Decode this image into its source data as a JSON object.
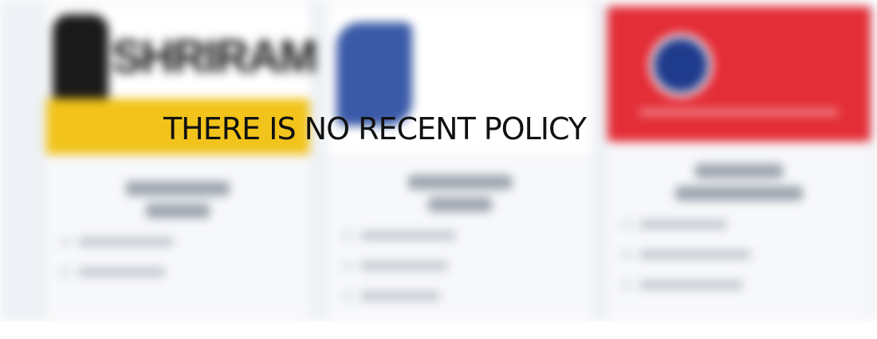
{
  "message": {
    "text": "THERE IS NO RECENT POLICY"
  },
  "background": {
    "note_colors": {
      "shriram_yellow": "#f2c31a",
      "manipal_blue": "#3a5aa8",
      "kotak_red": "#e32d37",
      "kotak_navy": "#1f3b8c"
    },
    "cards": [
      {
        "logo_icon": "shriram-logo",
        "logo_text": "SHRIRAM"
      },
      {
        "logo_icon": "manipal-cigna-logo"
      },
      {
        "logo_icon": "kotak-logo"
      }
    ]
  }
}
